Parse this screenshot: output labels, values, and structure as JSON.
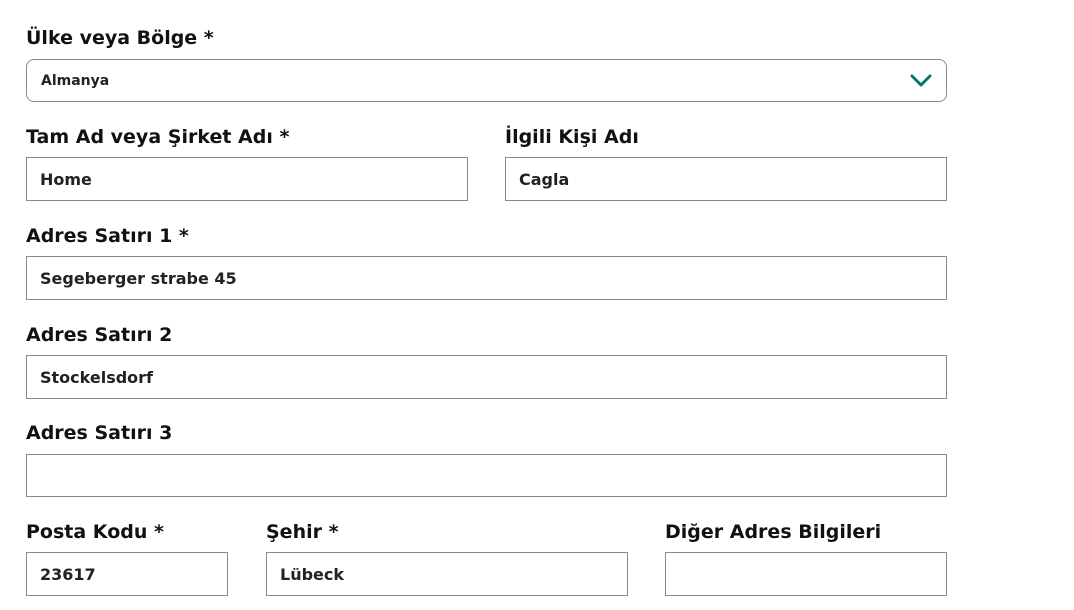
{
  "form": {
    "country": {
      "label": "Ülke veya Bölge *",
      "value": "Almanya",
      "accent_color": "#007a6e"
    },
    "full_name": {
      "label": "Tam Ad veya Şirket Adı *",
      "value": "Home"
    },
    "contact_name": {
      "label": "İlgili Kişi Adı",
      "value": "Cagla"
    },
    "address1": {
      "label": "Adres Satırı 1 *",
      "value": "Segeberger strabe 45"
    },
    "address2": {
      "label": "Adres Satırı 2",
      "value": "Stockelsdorf"
    },
    "address3": {
      "label": "Adres Satırı 3",
      "value": ""
    },
    "postal_code": {
      "label": "Posta Kodu *",
      "value": "23617"
    },
    "city": {
      "label": "Şehir *",
      "value": "Lübeck"
    },
    "other_address": {
      "label": "Diğer Adres Bilgileri",
      "value": ""
    }
  }
}
